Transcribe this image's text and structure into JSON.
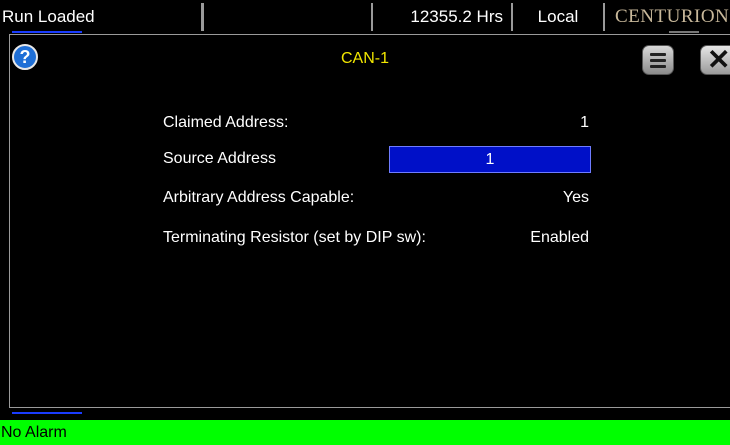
{
  "status_bar": {
    "state": "Run Loaded",
    "hours": "12355.2 Hrs",
    "mode": "Local",
    "brand": "CENTURION"
  },
  "dialog": {
    "title": "CAN-1",
    "help_icon": "help-icon",
    "menu_icon": "menu-icon",
    "close_icon": "close-icon",
    "close_glyph": "✕"
  },
  "fields": {
    "claimed_address": {
      "label": "Claimed Address:",
      "value": "1"
    },
    "source_address": {
      "label": "Source Address",
      "value": "1"
    },
    "arbitrary": {
      "label": "Arbitrary Address Capable:",
      "value": "Yes"
    },
    "terminating": {
      "label": "Terminating Resistor (set by DIP sw):",
      "value": "Enabled"
    }
  },
  "alarm": {
    "text": "No Alarm",
    "color": "#00ff00"
  },
  "colors": {
    "title": "#f2e700",
    "input_bg": "#0010c8"
  }
}
